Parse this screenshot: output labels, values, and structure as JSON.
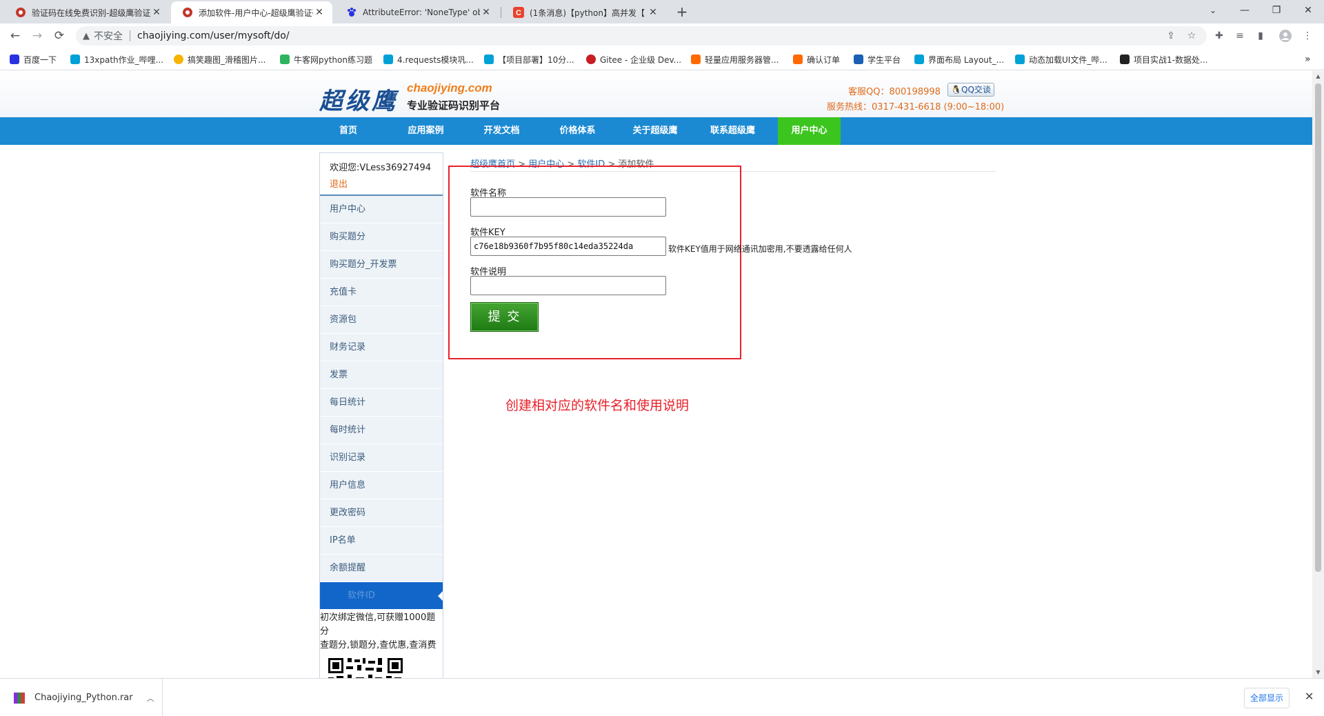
{
  "browser": {
    "tabs": [
      {
        "title": "验证码在线免费识别-超级鹰验证",
        "active": false
      },
      {
        "title": "添加软件-用户中心-超级鹰验证码",
        "active": true
      },
      {
        "title": "AttributeError: 'NoneType' obj",
        "active": false
      },
      {
        "title": "(1条消息)【python】高并发【",
        "active": false
      }
    ],
    "new_tab": "+",
    "window_controls": {
      "minimize": "—",
      "restore": "❐",
      "close": "✕"
    },
    "toolbar": {
      "back": "←",
      "forward": "→",
      "reload": "⟳",
      "security_label": "不安全",
      "url": "chaojiying.com/user/mysoft/do/"
    },
    "bookmarks": [
      {
        "label": "百度一下",
        "icon": "paw-icon",
        "color": "#2932e1"
      },
      {
        "label": "13xpath作业_哔哩...",
        "icon": "bilibili-icon",
        "color": "#00a1d6"
      },
      {
        "label": "搞笑趣图_滑稽图片...",
        "icon": "smiley-icon",
        "color": "#f5b400"
      },
      {
        "label": "牛客网python练习题",
        "icon": "nowcoder-icon",
        "color": "#2db55d"
      },
      {
        "label": "4.requests模块巩...",
        "icon": "bilibili-icon",
        "color": "#00a1d6"
      },
      {
        "label": "【项目部署】10分...",
        "icon": "bilibili-icon",
        "color": "#00a1d6"
      },
      {
        "label": "Gitee - 企业级 Dev...",
        "icon": "gitee-icon",
        "color": "#c71d23"
      },
      {
        "label": "轻量应用服务器管...",
        "icon": "aliyun-icon",
        "color": "#ff6a00"
      },
      {
        "label": "确认订单",
        "icon": "aliyun-icon",
        "color": "#ff6a00"
      },
      {
        "label": "学生平台",
        "icon": "platform-icon",
        "color": "#1a5fb4"
      },
      {
        "label": "界面布局 Layout_...",
        "icon": "bilibili-icon",
        "color": "#00a1d6"
      },
      {
        "label": "动态加载UI文件_哔...",
        "icon": "bilibili-icon",
        "color": "#00a1d6"
      },
      {
        "label": "项目实战1-数据处...",
        "icon": "project-icon",
        "color": "#222222"
      }
    ],
    "bookmarks_overflow": "»"
  },
  "site": {
    "logo_cn": "超级鹰",
    "logo_en": "chaojiying.com",
    "logo_sub": "专业验证码识别平台",
    "service_qq": "客服QQ：800198998",
    "qq_button": "QQ交谈",
    "hotline": "服务热线：0317-431-6618 (9:00~18:00)",
    "nav": [
      "首页",
      "应用案例",
      "开发文档",
      "价格体系",
      "关于超级鹰",
      "联系超级鹰",
      "用户中心"
    ],
    "nav_active_index": 6,
    "welcome_text": "欢迎您:VLess36927494",
    "logout": "退出",
    "sidebar_items": [
      "用户中心",
      "购买题分",
      "购买题分_开发票",
      "充值卡",
      "资源包",
      "财务记录",
      "发票",
      "每日统计",
      "每时统计",
      "识别记录",
      "用户信息",
      "更改密码",
      "IP名单",
      "余额提醒"
    ],
    "sidebar_active": "软件ID",
    "promo_line1": "初次绑定微信,可获赠1000题分",
    "promo_line2": "查题分,锁题分,查优惠,查消费",
    "breadcrumb": {
      "home": "超级鹰首页",
      "sep1": " > ",
      "user_center": "用户中心",
      "sep2": " > ",
      "software_id": "软件ID",
      "sep3": " > ",
      "current": "添加软件"
    },
    "form": {
      "name_label": "软件名称",
      "name_value": "",
      "key_label": "软件KEY",
      "key_value": "c76e18b9360f7b95f80c14eda35224da",
      "key_hint": "软件KEY值用于网络通讯加密用,不要透露给任何人",
      "desc_label": "软件说明",
      "desc_value": "",
      "submit": "提 交"
    },
    "annotation": "创建相对应的软件名和使用说明"
  },
  "download_bar": {
    "file": "Chaojiying_Python.rar",
    "show_all": "全部显示",
    "close": "✕"
  },
  "colors": {
    "nav_blue": "#1b8ad3",
    "nav_active_green": "#3cc51e",
    "annotation_red": "#e8202a",
    "brand_orange": "#e06a1a",
    "submit_green": "#2e8f1f"
  }
}
